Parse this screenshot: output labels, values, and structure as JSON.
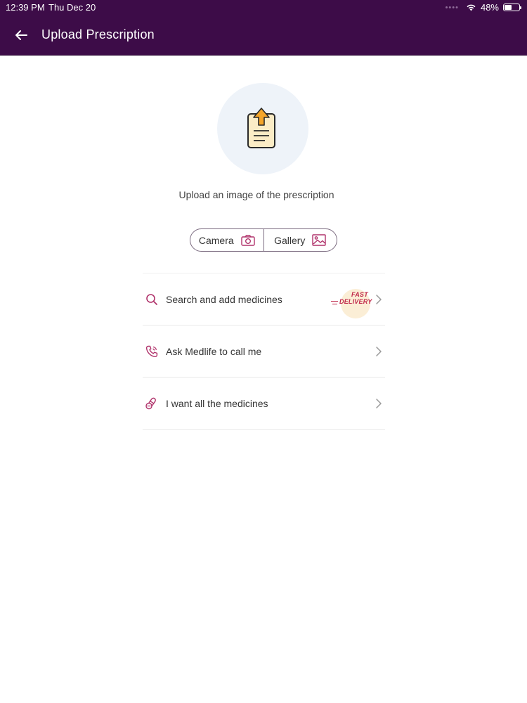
{
  "status_bar": {
    "time": "12:39 PM",
    "date": "Thu Dec 20",
    "battery": "48%"
  },
  "header": {
    "title": "Upload Prescription",
    "back_icon": "arrow-left-icon"
  },
  "upload": {
    "icon": "prescription-upload-icon",
    "caption": "Upload an image of the prescription",
    "camera_label": "Camera",
    "gallery_label": "Gallery"
  },
  "options": [
    {
      "icon": "search-icon",
      "label": "Search and add medicines",
      "badge_line1": "FAST",
      "badge_line2": "DELIVERY"
    },
    {
      "icon": "phone-icon",
      "label": "Ask Medlife to call me"
    },
    {
      "icon": "pills-icon",
      "label": "I want all the medicines"
    }
  ],
  "colors": {
    "header_bg": "#3d0c48",
    "accent": "#b0336b",
    "badge_text": "#c0284a"
  }
}
